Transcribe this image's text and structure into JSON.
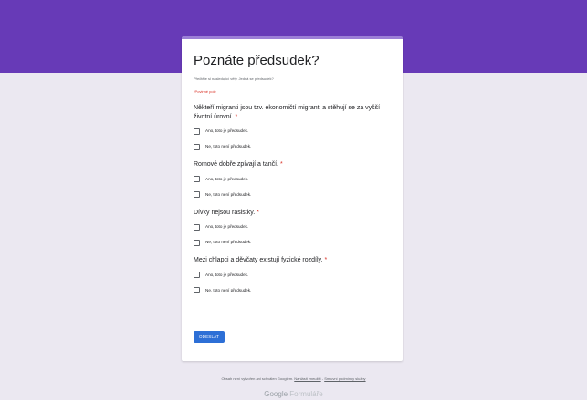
{
  "form": {
    "title": "Poznáte předsudek?",
    "description": "Přečtěte si následující věty. Jedná se předsudek?",
    "required_note": "*Povinné pole",
    "required_marker": "*",
    "submit_label": "ODESLAT",
    "questions": [
      {
        "title": "Někteří migranti jsou tzv. ekonomičtí migranti a stěhují se za vyšší životní úrovní.",
        "options": [
          "Ano, toto je předsudek.",
          "Ne, toto není předsudek."
        ]
      },
      {
        "title": "Romové dobře zpívají a tančí.",
        "options": [
          "Ano, toto je předsudek.",
          "Ne, toto není předsudek."
        ]
      },
      {
        "title": "Dívky nejsou rasistky.",
        "options": [
          "Ano, toto je předsudek.",
          "Ne, toto není předsudek."
        ]
      },
      {
        "title": "Mezi chlapci a děvčaty existují fyzické rozdíly.",
        "options": [
          "Ano, toto je předsudek.",
          "Ne, toto není předsudek."
        ]
      }
    ]
  },
  "footer": {
    "note": "Obsah není vytvořen ani schválen Googlem.",
    "report_link": "Nahlásit zneužití",
    "separator": " - ",
    "terms_link": "Smluvní podmínky služby",
    "brand_google": "Google",
    "brand_product": "Formuláře"
  },
  "colors": {
    "header": "#673ab7",
    "background": "#ebe8f1",
    "submit": "#2d6fd6",
    "required": "#d93025"
  }
}
